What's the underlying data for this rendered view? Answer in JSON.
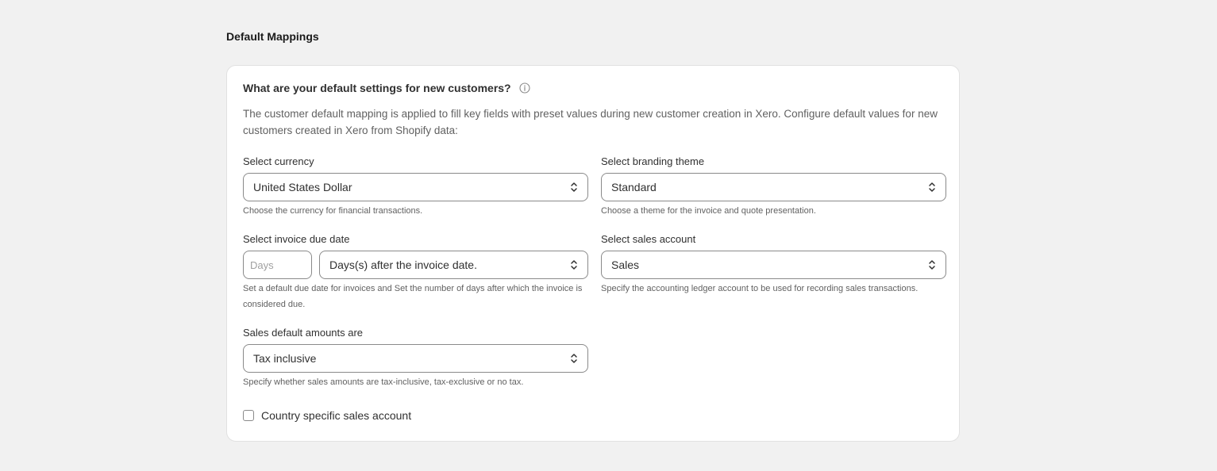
{
  "section": {
    "title": "Default Mappings"
  },
  "card": {
    "heading": "What are your default settings for new customers?",
    "description": "The customer default mapping is applied to fill key fields with preset values during new customer creation in Xero. Configure default values for new customers created in Xero from Shopify data:"
  },
  "currency": {
    "label": "Select currency",
    "value": "United States Dollar",
    "help": "Choose the currency for financial transactions."
  },
  "branding": {
    "label": "Select branding theme",
    "value": "Standard",
    "help": "Choose a theme for the invoice and quote presentation."
  },
  "due_date": {
    "label": "Select invoice due date",
    "days_placeholder": "Days",
    "days_value": "",
    "term_value": "Days(s) after the invoice date.",
    "help": "Set a default due date for invoices and Set the number of days after which the invoice is considered due."
  },
  "sales_account": {
    "label": "Select sales account",
    "value": "Sales",
    "help": "Specify the accounting ledger account to be used for recording sales transactions."
  },
  "amounts": {
    "label": "Sales default amounts are",
    "value": "Tax inclusive",
    "help": "Specify whether sales amounts are tax-inclusive, tax-exclusive or no tax."
  },
  "country_checkbox": {
    "label": "Country specific sales account",
    "checked": false
  },
  "icons": {
    "info": "info-icon",
    "select": "chevron-up-down-icon"
  },
  "colors": {
    "background": "#f1f1f1",
    "card": "#ffffff",
    "border": "#8a8a8a",
    "muted_text": "#616161"
  }
}
